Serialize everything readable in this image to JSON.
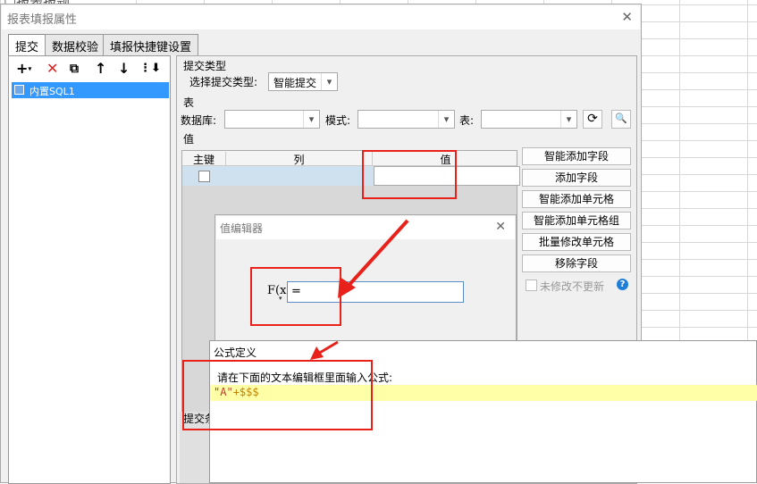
{
  "background": {
    "partial_text": "□报表报题"
  },
  "main_dialog": {
    "title": "报表填报属性",
    "close": "✕",
    "tabs": [
      {
        "label": "提交",
        "active": true
      },
      {
        "label": "数据校验",
        "active": false
      },
      {
        "label": "填报快捷键设置",
        "active": false
      }
    ],
    "list_item": "内置SQL1",
    "submit_type_section": "提交类型",
    "submit_type_label": "选择提交类型:",
    "submit_type_value": "智能提交",
    "table_section": "表",
    "db_label": "数据库:",
    "schema_label": "模式:",
    "table_label": "表:",
    "value_section": "值",
    "columns": {
      "key": "主键",
      "col": "列",
      "value": "值"
    },
    "buttons": [
      "智能添加字段",
      "添加字段",
      "智能添加单元格",
      "智能添加单元格组",
      "批量修改单元格",
      "移除字段"
    ],
    "no_update_label": "未修改不更新",
    "bottom_partial": "提交条"
  },
  "value_editor": {
    "title": "值编辑器",
    "close": "✕",
    "fx_label": "F(x)",
    "input_value": "="
  },
  "formula_dialog": {
    "title": "公式定义",
    "hint": "请在下面的文本编辑框里面输入公式:",
    "code_string": "\"A\"",
    "code_rest": "+$$$"
  },
  "colors": {
    "annotation": "#e8221b",
    "selection": "#3399ff",
    "editor_highlight": "#ffffa8"
  }
}
